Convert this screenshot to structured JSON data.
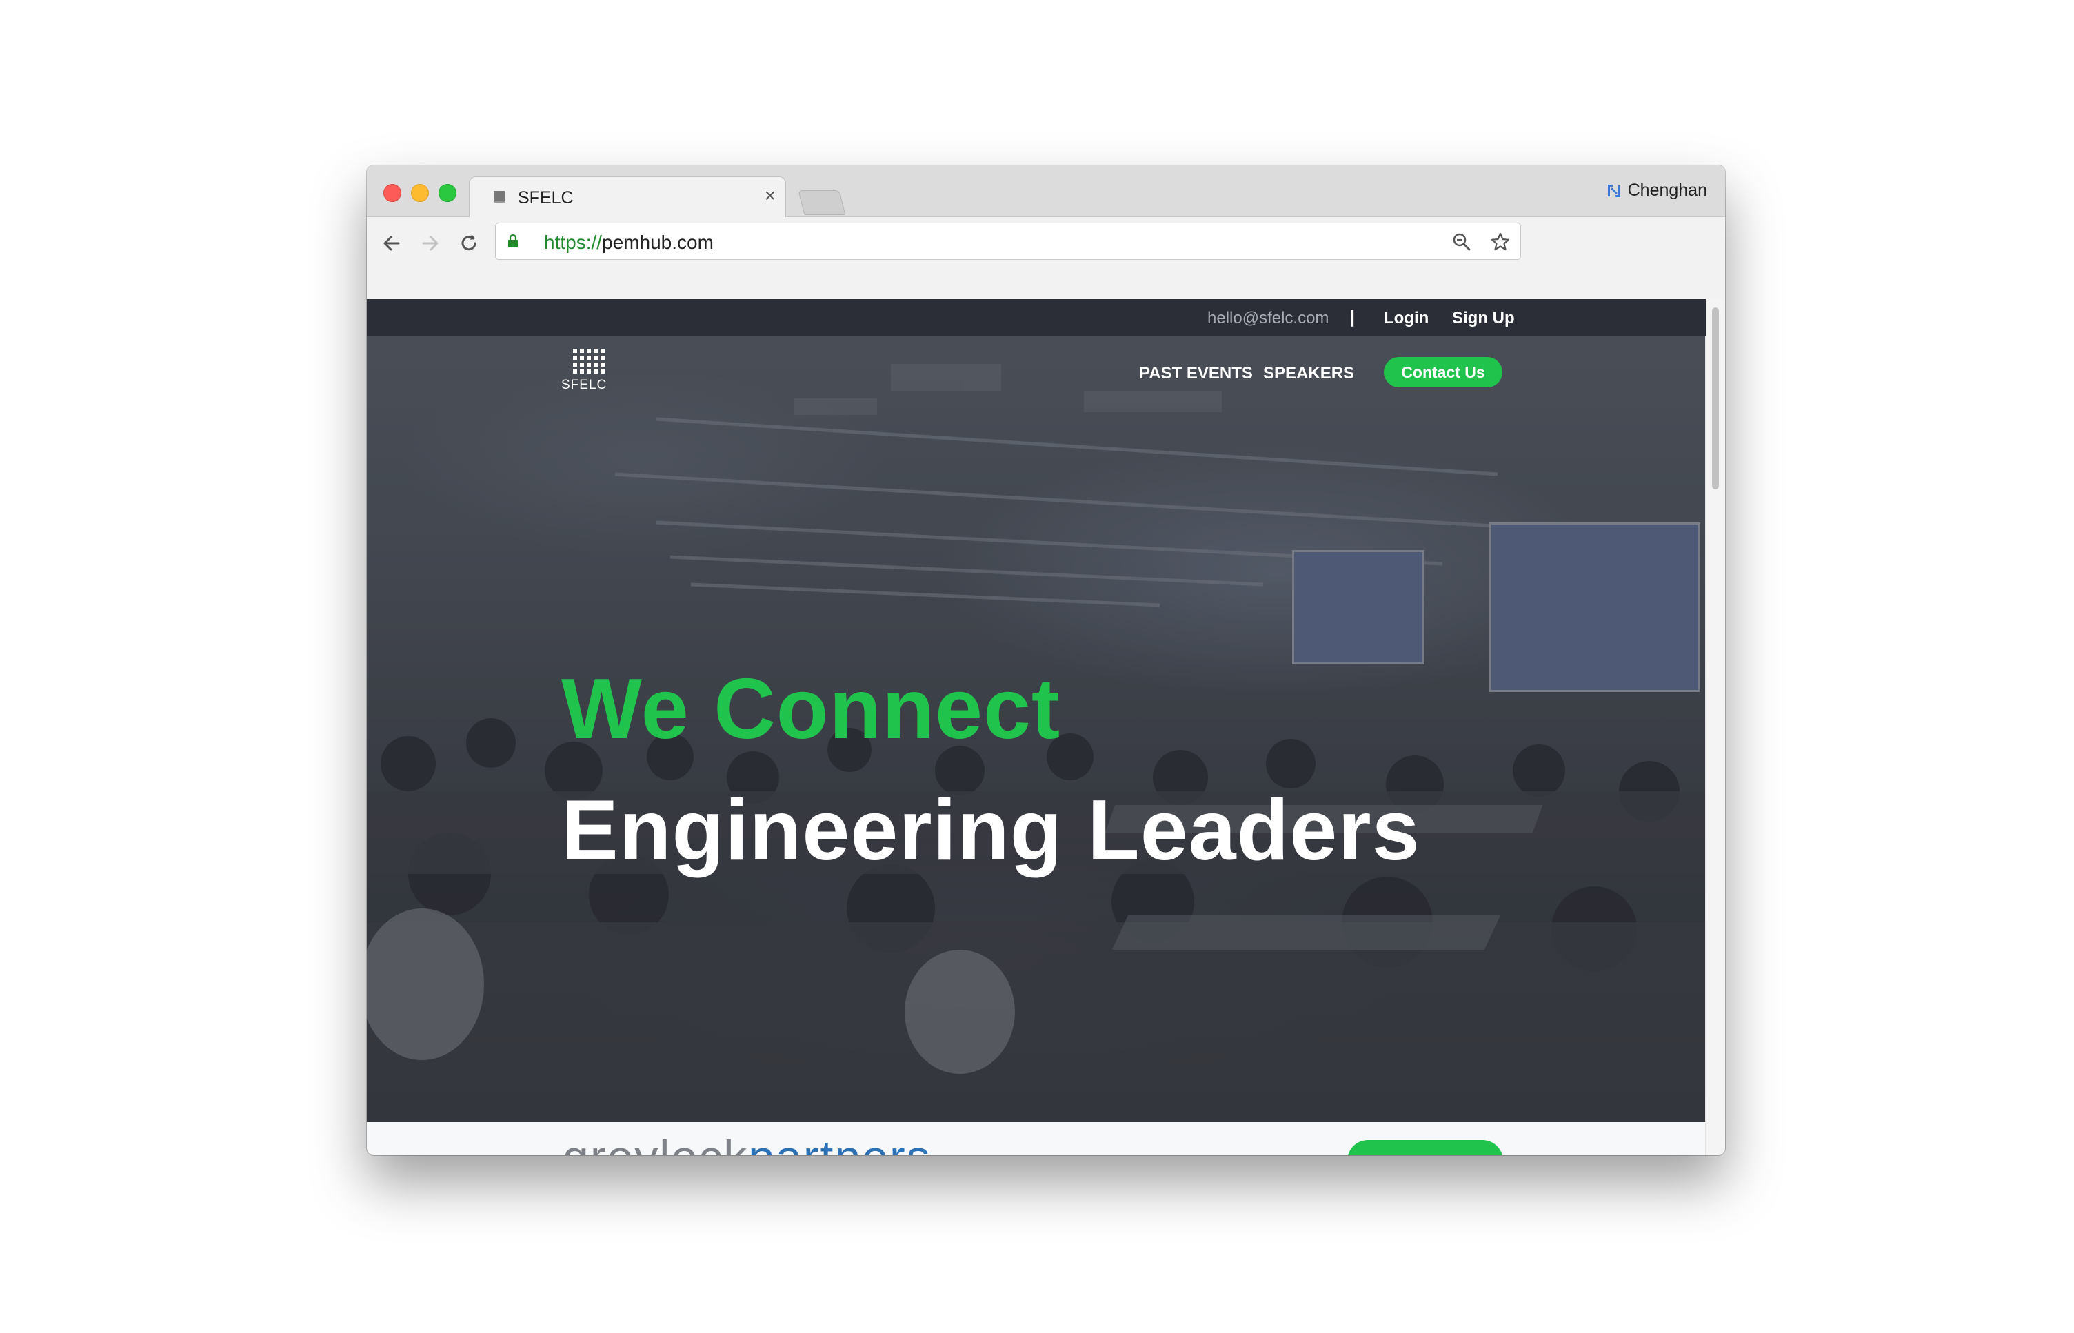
{
  "browser": {
    "tab": {
      "title": "SFELC",
      "close_glyph": "×"
    },
    "profile": {
      "name": "Chenghan"
    },
    "address": {
      "scheme": "https://",
      "host": "pemhub.com"
    },
    "icons": [
      "back-icon",
      "forward-icon",
      "reload-icon",
      "lock-icon",
      "zoom-icon",
      "bookmark-star-icon"
    ]
  },
  "site": {
    "topbar": {
      "email": "hello@sfelc.com",
      "separator": "|",
      "login": "Login",
      "signup": "Sign Up"
    },
    "logo": {
      "text": "SFELC"
    },
    "nav": {
      "past_events": "PAST EVENTS",
      "speakers": "SPEAKERS",
      "contact": "Contact Us"
    },
    "hero": {
      "line1": "We Connect",
      "line2": "Engineering Leaders"
    },
    "partner": {
      "part1": "greylock",
      "part2": "partners"
    }
  },
  "colors": {
    "accent_green": "#20c44d",
    "topbar_bg": "#2b2e37",
    "partner_blue": "#2a71b5"
  }
}
